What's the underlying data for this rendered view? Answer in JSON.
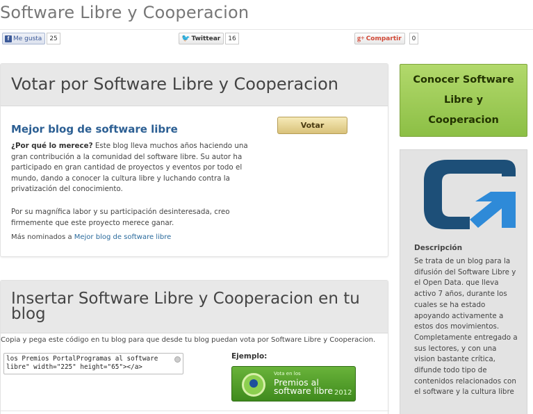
{
  "page": {
    "title": "Software Libre y Cooperacion"
  },
  "share": {
    "facebook": {
      "label": "Me gusta",
      "count": "25"
    },
    "twitter": {
      "label": "Twittear",
      "count": "16"
    },
    "google": {
      "label": "Compartir",
      "count": "0"
    }
  },
  "vote": {
    "heading": "Votar por Software Libre y Cooperacion",
    "category": "Mejor blog de software libre",
    "button": "Votar",
    "why_label": "¿Por qué lo merece?",
    "why_text": " Este blog lleva muchos años haciendo una gran contribución a la comunidad del software libre. Su autor ha participado en gran cantidad de proyectos y eventos por todo el mundo, dando a conocer la cultura libre y luchando contra la privatización del conocimiento.",
    "why_text2": "Por su magnífica labor y su participación desinteresada, creo firmemente que este proyecto merece ganar.",
    "more_prefix": "Más nominados a ",
    "more_link": "Mejor blog de software libre"
  },
  "embed": {
    "heading": "Insertar Software Libre y Cooperacion en tu blog",
    "instructions": "Copia y pega este código en tu blog para que desde tu blog puedan vota por Software Libre y Cooperacion.",
    "code": "los Premios PortalProgramas al software libre\" width=\"225\" height=\"65\"></a>",
    "example_label": "Ejemplo:",
    "badge": {
      "small": "Vota en los",
      "line1": "Premios al",
      "line2": "software libre",
      "year": "2012"
    }
  },
  "sidebar": {
    "know_button": "Conocer Software Libre y Cooperacion",
    "desc_title": "Descripción",
    "desc_body": "Se trata de un blog para la difusión del Software Libre y el Open Data. que lleva activo 7 años, durante los cuales se ha estado apoyando activamente a estos dos movimientos. Completamente entregado a sus lectores, y con una vision bastante crítica, difunde todo tipo de contenidos relacionados con el software y la cultura libre"
  },
  "colors": {
    "accent_green": "#8cbf45",
    "link_blue": "#2c5f93",
    "logo_blue": "#1d4f78",
    "logo_arrow": "#2e8ad8"
  }
}
